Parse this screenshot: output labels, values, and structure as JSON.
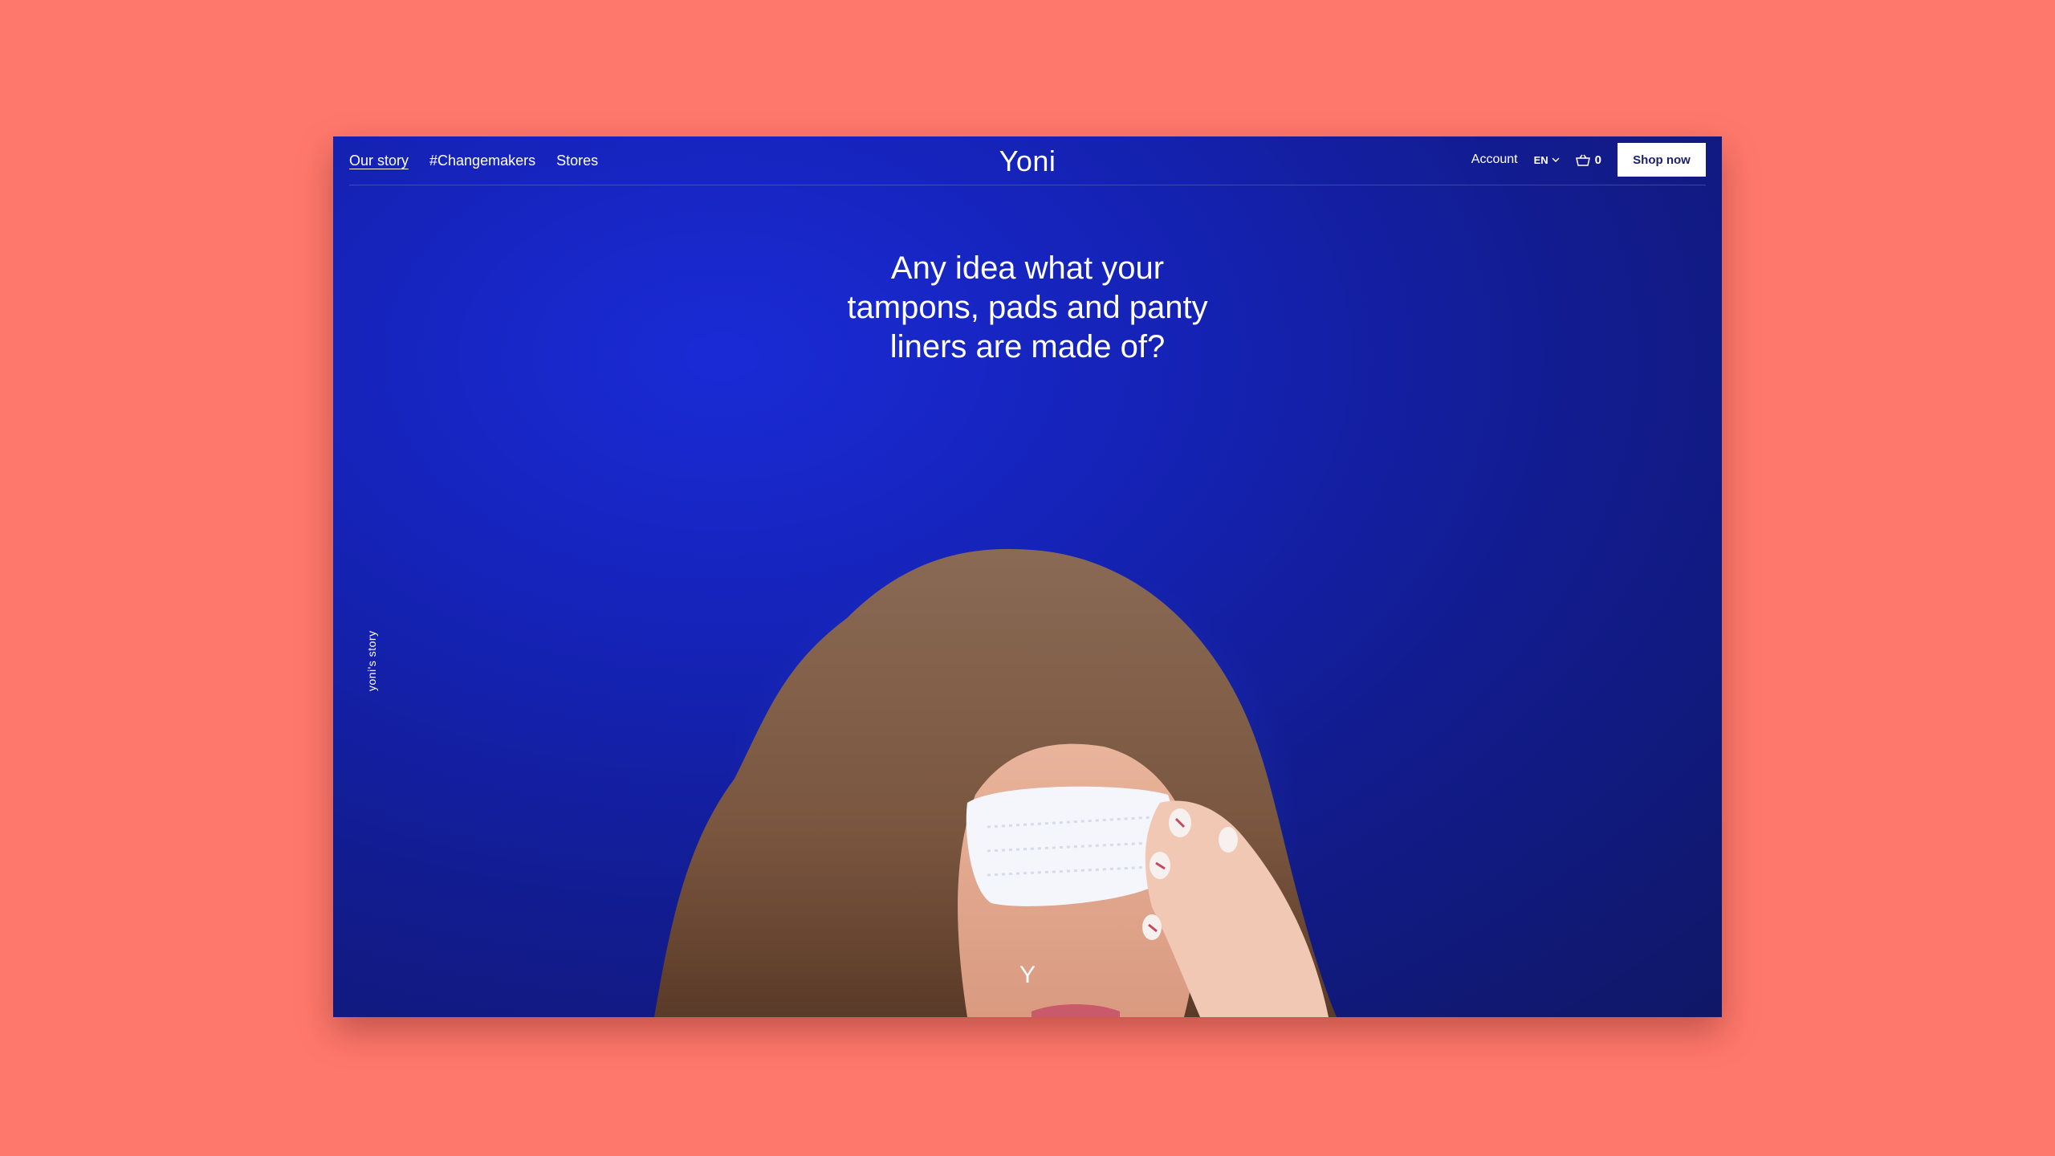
{
  "nav": {
    "links": [
      {
        "label": "Our story",
        "active": true
      },
      {
        "label": "#Changemakers",
        "active": false
      },
      {
        "label": "Stores",
        "active": false
      }
    ],
    "logo": "Yoni",
    "account": "Account",
    "language": "EN",
    "cart_count": "0",
    "shop_button": "Shop now"
  },
  "hero": {
    "headline_lines": [
      "Any idea what your",
      "tampons, pads and panty",
      "liners are made of?"
    ],
    "side_label": "yoni's story",
    "bottom_mark": "Y"
  },
  "colors": {
    "background": "#ff786b",
    "hero_blue": "#1523b8",
    "hero_dark": "#0f1766",
    "button_text": "#1a1f6e"
  },
  "icons": [
    "chevron-down-icon",
    "basket-icon"
  ]
}
